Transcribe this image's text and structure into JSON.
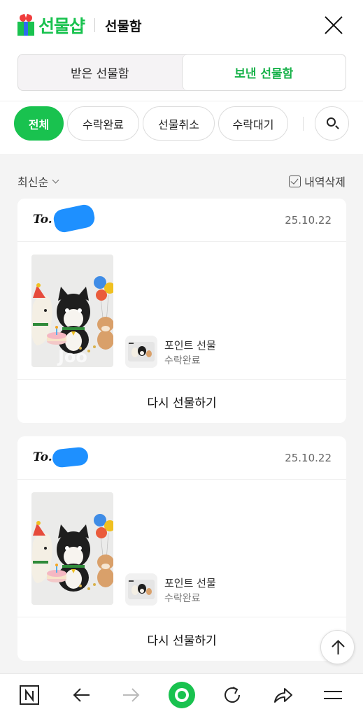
{
  "header": {
    "logo_text": "선물샵",
    "title": "선물함",
    "close_icon": "close-icon"
  },
  "tabs": [
    {
      "label": "받은 선물함",
      "active": false
    },
    {
      "label": "보낸 선물함",
      "active": true
    }
  ],
  "filters": [
    {
      "label": "전체",
      "active": true
    },
    {
      "label": "수락완료",
      "active": false
    },
    {
      "label": "선물취소",
      "active": false
    },
    {
      "label": "수락대기",
      "active": false
    }
  ],
  "sort": {
    "label": "최신순",
    "delete_label": "내역삭제"
  },
  "cards": [
    {
      "to_label": "To.",
      "date": "25.10.22",
      "item_name": "포인트 선물",
      "item_status": "수락완료",
      "action_label": "다시 선물하기",
      "watermark": "Joo"
    },
    {
      "to_label": "To.",
      "date": "25.10.22",
      "item_name": "포인트 선물",
      "item_status": "수락완료",
      "action_label": "다시 선물하기",
      "watermark": ""
    }
  ],
  "colors": {
    "brand_green": "#19c24f",
    "redaction_blue": "#1e90ff"
  },
  "bottom_nav": [
    "naver-home-icon",
    "back-icon",
    "forward-icon",
    "green-dot-icon",
    "refresh-icon",
    "share-icon",
    "menu-icon"
  ]
}
